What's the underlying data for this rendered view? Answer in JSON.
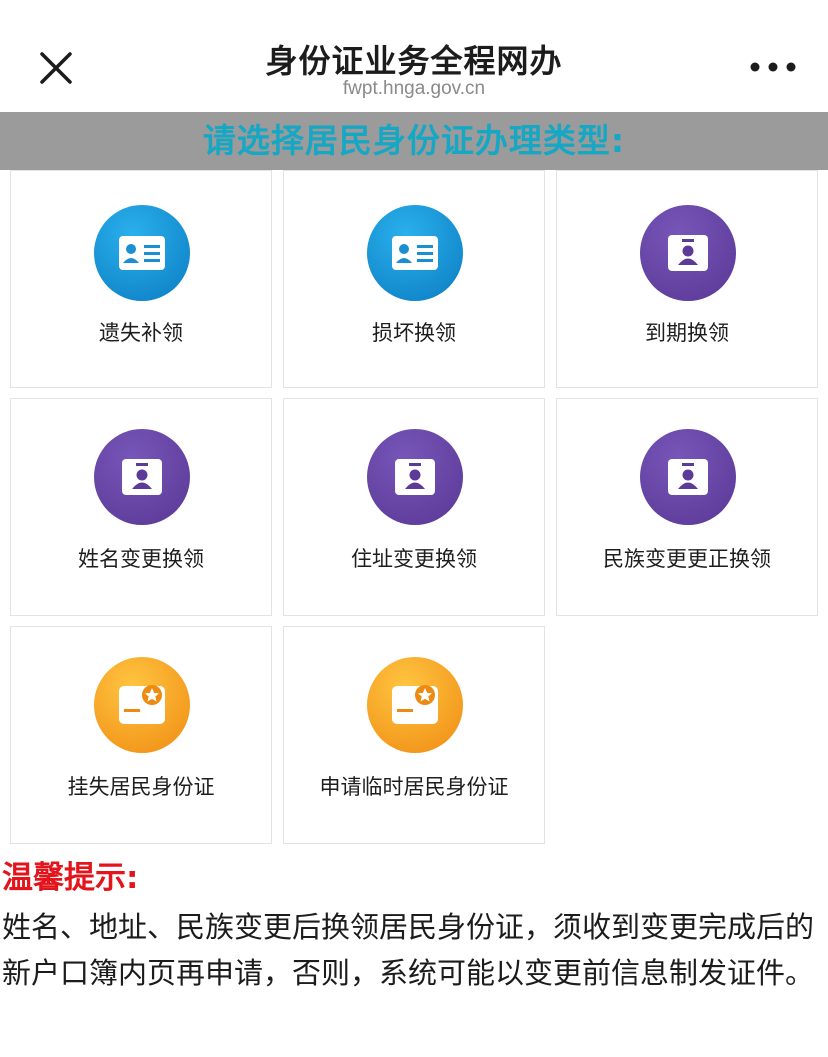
{
  "header": {
    "title": "身份证业务全程网办",
    "url": "fwpt.hnga.gov.cn"
  },
  "banner": {
    "text": "请选择居民身份证办理类型:"
  },
  "colors": {
    "banner_bg": "#9b9b9b",
    "banner_text": "#16a7c4",
    "tip_title": "#e3141b"
  },
  "services": [
    {
      "label": "遗失补领",
      "icon": "id-card-icon",
      "color": "blue"
    },
    {
      "label": "损坏换领",
      "icon": "id-card-icon",
      "color": "blue"
    },
    {
      "label": "到期换领",
      "icon": "id-badge-icon",
      "color": "purple"
    },
    {
      "label": "姓名变更换领",
      "icon": "id-badge-icon",
      "color": "purple"
    },
    {
      "label": "住址变更换领",
      "icon": "id-badge-icon",
      "color": "purple"
    },
    {
      "label": "民族变更更正换领",
      "icon": "id-badge-icon",
      "color": "purple"
    },
    {
      "label": "挂失居民身份证",
      "icon": "star-card-icon",
      "color": "orange"
    },
    {
      "label": "申请临时居民身份证",
      "icon": "star-card-icon",
      "color": "orange"
    }
  ],
  "tip": {
    "title": "温馨提示:",
    "body": "姓名、地址、民族变更后换领居民身份证，须收到变更完成后的新户口簿内页再申请，否则，系统可能以变更前信息制发证件。"
  }
}
